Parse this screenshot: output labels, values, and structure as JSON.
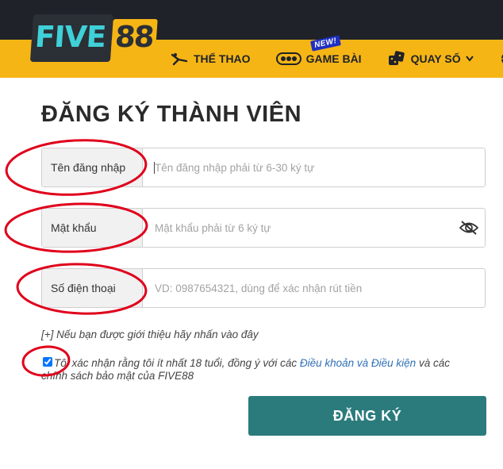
{
  "header": {
    "logo_text": "FIVE88",
    "nav": [
      {
        "label": "THỂ THAO",
        "icon": "sports-icon"
      },
      {
        "label": "GAME BÀI",
        "icon": "cards-icon",
        "badge": "NEW!"
      },
      {
        "label": "QUAY SỐ",
        "icon": "dice-icon"
      },
      {
        "label": "",
        "icon": "globe-icon"
      }
    ]
  },
  "form": {
    "title": "ĐĂNG KÝ THÀNH VIÊN",
    "username": {
      "label": "Tên đăng nhập",
      "placeholder": "Tên đăng nhập phải từ 6-30 ký tự",
      "value": ""
    },
    "password": {
      "label": "Mật khẩu",
      "placeholder": "Mật khẩu phải từ 6 ký tự",
      "value": ""
    },
    "phone": {
      "label": "Số điện thoại",
      "placeholder": "VD: 0987654321, dùng để xác nhận rút tiền",
      "value": ""
    },
    "referral_text": "[+] Nếu bạn được giới thiệu hãy nhấn vào đây",
    "agree": {
      "checked": true,
      "text_before": "Tôi xác nhận rằng tôi ít nhất 18 tuổi, đồng ý với các ",
      "link": "Điều khoản và Điều kiện",
      "text_after": " và các chính sách bảo mật của FIVE88"
    },
    "submit_label": "ĐĂNG KÝ"
  },
  "colors": {
    "nav_yellow": "#f5b515",
    "top_dark": "#1f2228",
    "logo_cyan": "#3fd0d8",
    "submit_teal": "#2b7b7d",
    "link_blue": "#2f6fb6",
    "annotation_red": "#e0001b"
  }
}
